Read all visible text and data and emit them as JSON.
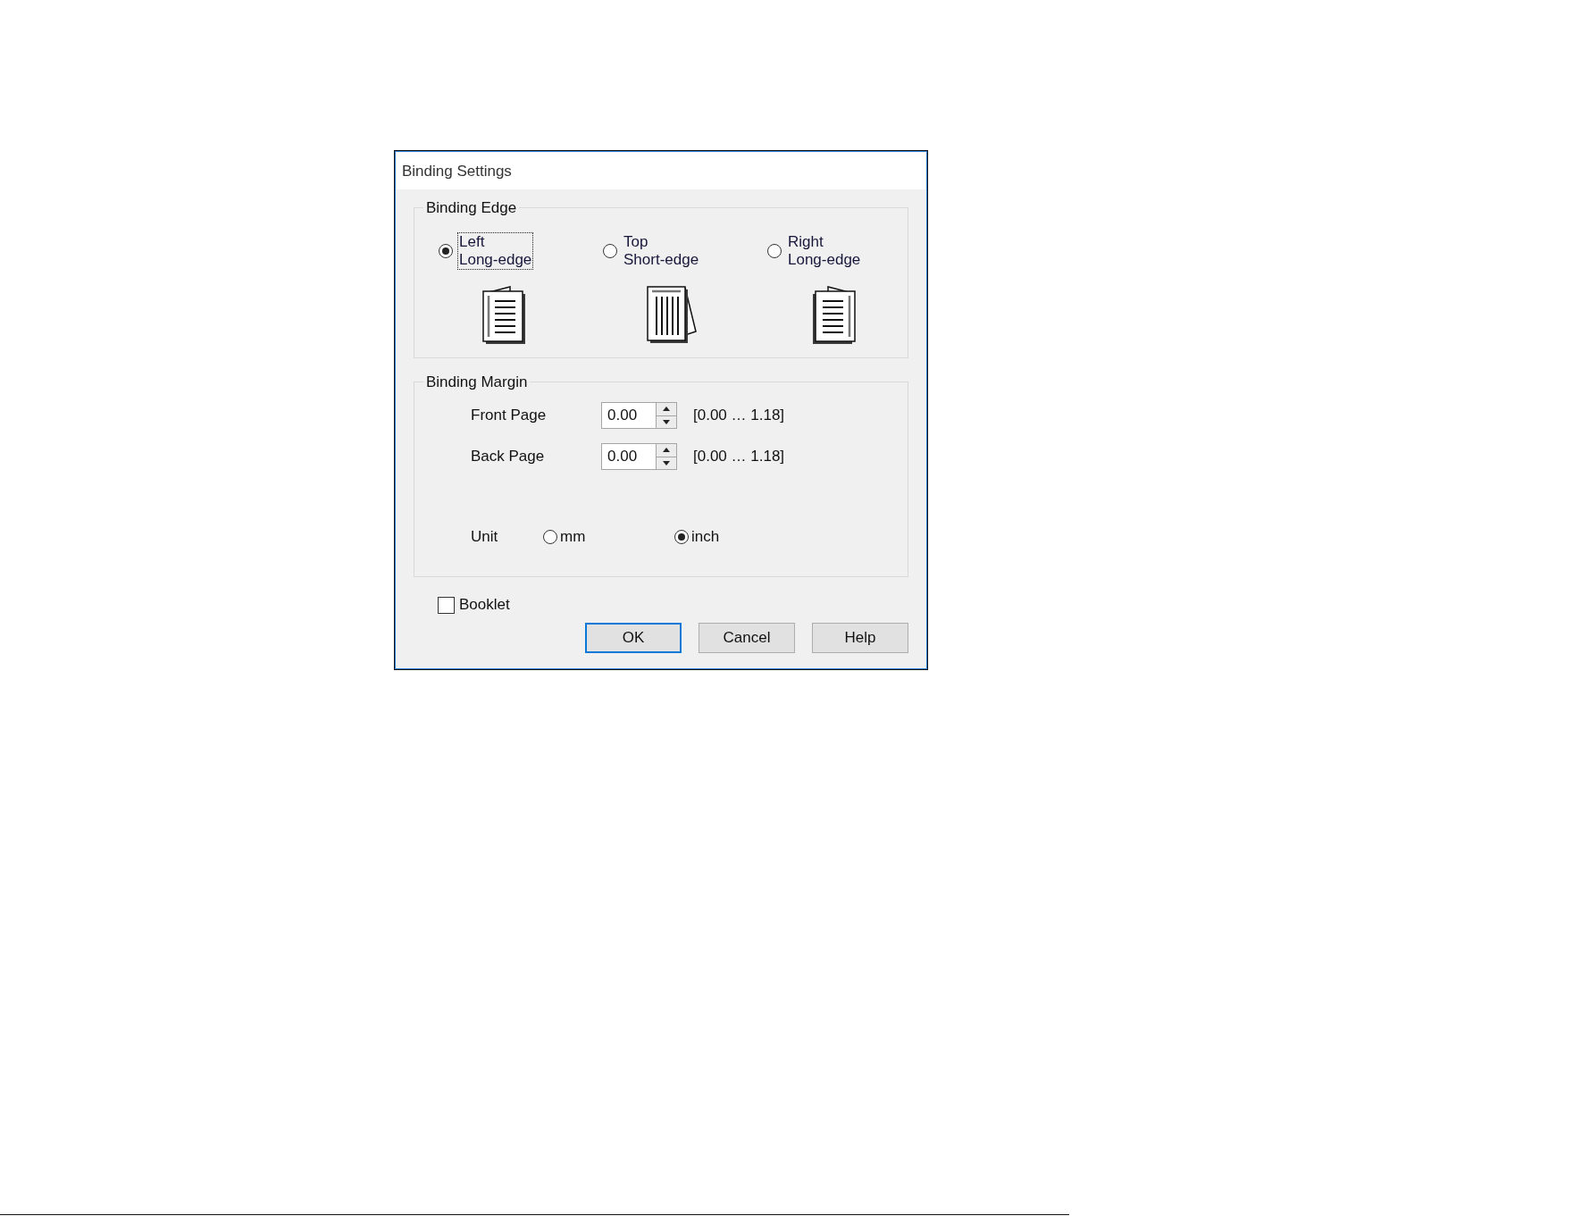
{
  "window": {
    "title": "Binding Settings"
  },
  "binding_edge": {
    "label": "Binding Edge",
    "options": [
      {
        "kind": "left",
        "line_1": "Left",
        "line_2": "Long-edge",
        "selected": true,
        "focused": true
      },
      {
        "kind": "top",
        "line_1": "Top",
        "line_2": "Short-edge",
        "selected": false,
        "focused": false
      },
      {
        "kind": "right",
        "line_1": "Right",
        "line_2": "Long-edge",
        "selected": false,
        "focused": false
      }
    ]
  },
  "binding_margin": {
    "label": "Binding Margin",
    "fields": [
      {
        "label": "Front Page",
        "value": "0.00",
        "range": "[0.00 … 1.18]"
      },
      {
        "label": "Back Page",
        "value": "0.00",
        "range": "[0.00 … 1.18]"
      }
    ],
    "unit": {
      "label": "Unit",
      "options": [
        {
          "label": "mm",
          "selected": false
        },
        {
          "label": "inch",
          "selected": true
        }
      ]
    }
  },
  "booklet": {
    "label": "Booklet",
    "checked": false
  },
  "buttons": [
    {
      "label": "OK",
      "default": true
    },
    {
      "label": "Cancel",
      "default": false
    },
    {
      "label": "Help",
      "default": false
    }
  ]
}
